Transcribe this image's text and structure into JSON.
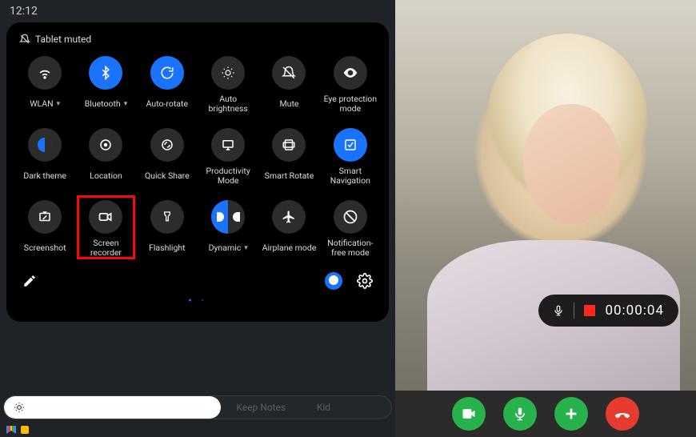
{
  "status": {
    "time": "12:12",
    "muted_label": "Tablet muted"
  },
  "tiles": [
    {
      "id": "wlan",
      "label": "WLAN",
      "active": false,
      "hasChevron": true
    },
    {
      "id": "bluetooth",
      "label": "Bluetooth",
      "active": true,
      "hasChevron": true
    },
    {
      "id": "autorotate",
      "label": "Auto-rotate",
      "active": true
    },
    {
      "id": "autobrightness",
      "label": "Auto brightness",
      "active": false
    },
    {
      "id": "mute",
      "label": "Mute",
      "active": false
    },
    {
      "id": "eyeprotection",
      "label": "Eye protection mode",
      "active": false
    },
    {
      "id": "darktheme",
      "label": "Dark theme",
      "active": true
    },
    {
      "id": "location",
      "label": "Location",
      "active": false
    },
    {
      "id": "quickshare",
      "label": "Quick Share",
      "active": false
    },
    {
      "id": "productivity",
      "label": "Productivity Mode",
      "active": false
    },
    {
      "id": "smartrotate",
      "label": "Smart Rotate",
      "active": false
    },
    {
      "id": "smartnavigation",
      "label": "Smart Navigation",
      "active": true
    },
    {
      "id": "screenshot",
      "label": "Screenshot",
      "active": false
    },
    {
      "id": "screenrecorder",
      "label": "Screen recorder",
      "active": false,
      "highlighted": true
    },
    {
      "id": "flashlight",
      "label": "Flashlight",
      "active": false
    },
    {
      "id": "dynamic",
      "label": "Dynamic",
      "active": "half",
      "hasChevron": true
    },
    {
      "id": "airplane",
      "label": "Airplane mode",
      "active": false
    },
    {
      "id": "notificationfree",
      "label": "Notification-free mode",
      "active": false
    }
  ],
  "brightness": {
    "ghost_text_left": "Keep Notes",
    "ghost_text_right": "Kid"
  },
  "recording": {
    "timer": "00:00:04"
  }
}
